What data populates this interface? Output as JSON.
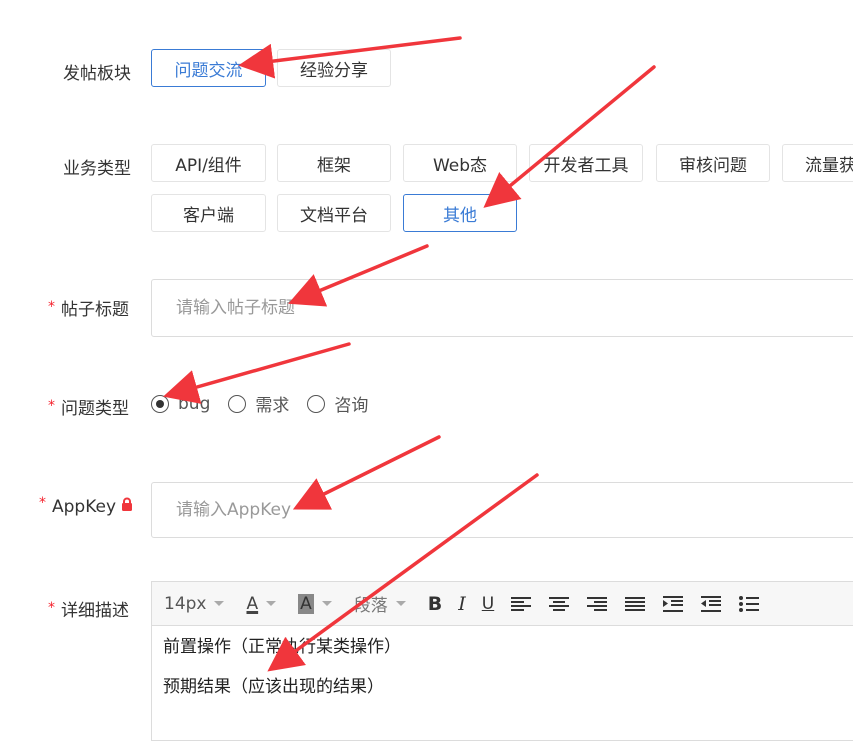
{
  "form": {
    "board": {
      "label": "发帖板块",
      "options": [
        "问题交流",
        "经验分享"
      ],
      "selected": "问题交流"
    },
    "business_type": {
      "label": "业务类型",
      "row1": [
        "API/组件",
        "框架",
        "Web态",
        "开发者工具",
        "审核问题",
        "流量获"
      ],
      "row2": [
        "客户端",
        "文档平台",
        "其他"
      ],
      "selected": "其他"
    },
    "title": {
      "required_mark": "*",
      "label": "帖子标题",
      "placeholder": "请输入帖子标题"
    },
    "issue_type": {
      "required_mark": "*",
      "label": "问题类型",
      "options": [
        "bug",
        "需求",
        "咨询"
      ],
      "selected": "bug"
    },
    "appkey": {
      "required_mark": "*",
      "label": "AppKey",
      "placeholder": "请输入AppKey",
      "lock_icon": "lock-icon"
    },
    "description": {
      "required_mark": "*",
      "label": "详细描述",
      "toolbar": {
        "font_size": "14px",
        "font_color_glyph": "A",
        "bg_color_glyph": "A",
        "paragraph": "段落",
        "bold": "B",
        "italic": "I",
        "underline": "U",
        "icons": [
          "align-left-icon",
          "align-center-icon",
          "align-right-icon",
          "align-justify-icon",
          "indent-icon",
          "outdent-icon",
          "bullet-list-icon"
        ]
      },
      "content": [
        "前置操作（正常执行某类操作）",
        "预期结果（应该出现的结果）"
      ]
    }
  },
  "annotations": {
    "arrow_color": "#f0363c"
  },
  "colors": {
    "accent": "#3a7bd5",
    "required": "#f5222d"
  }
}
